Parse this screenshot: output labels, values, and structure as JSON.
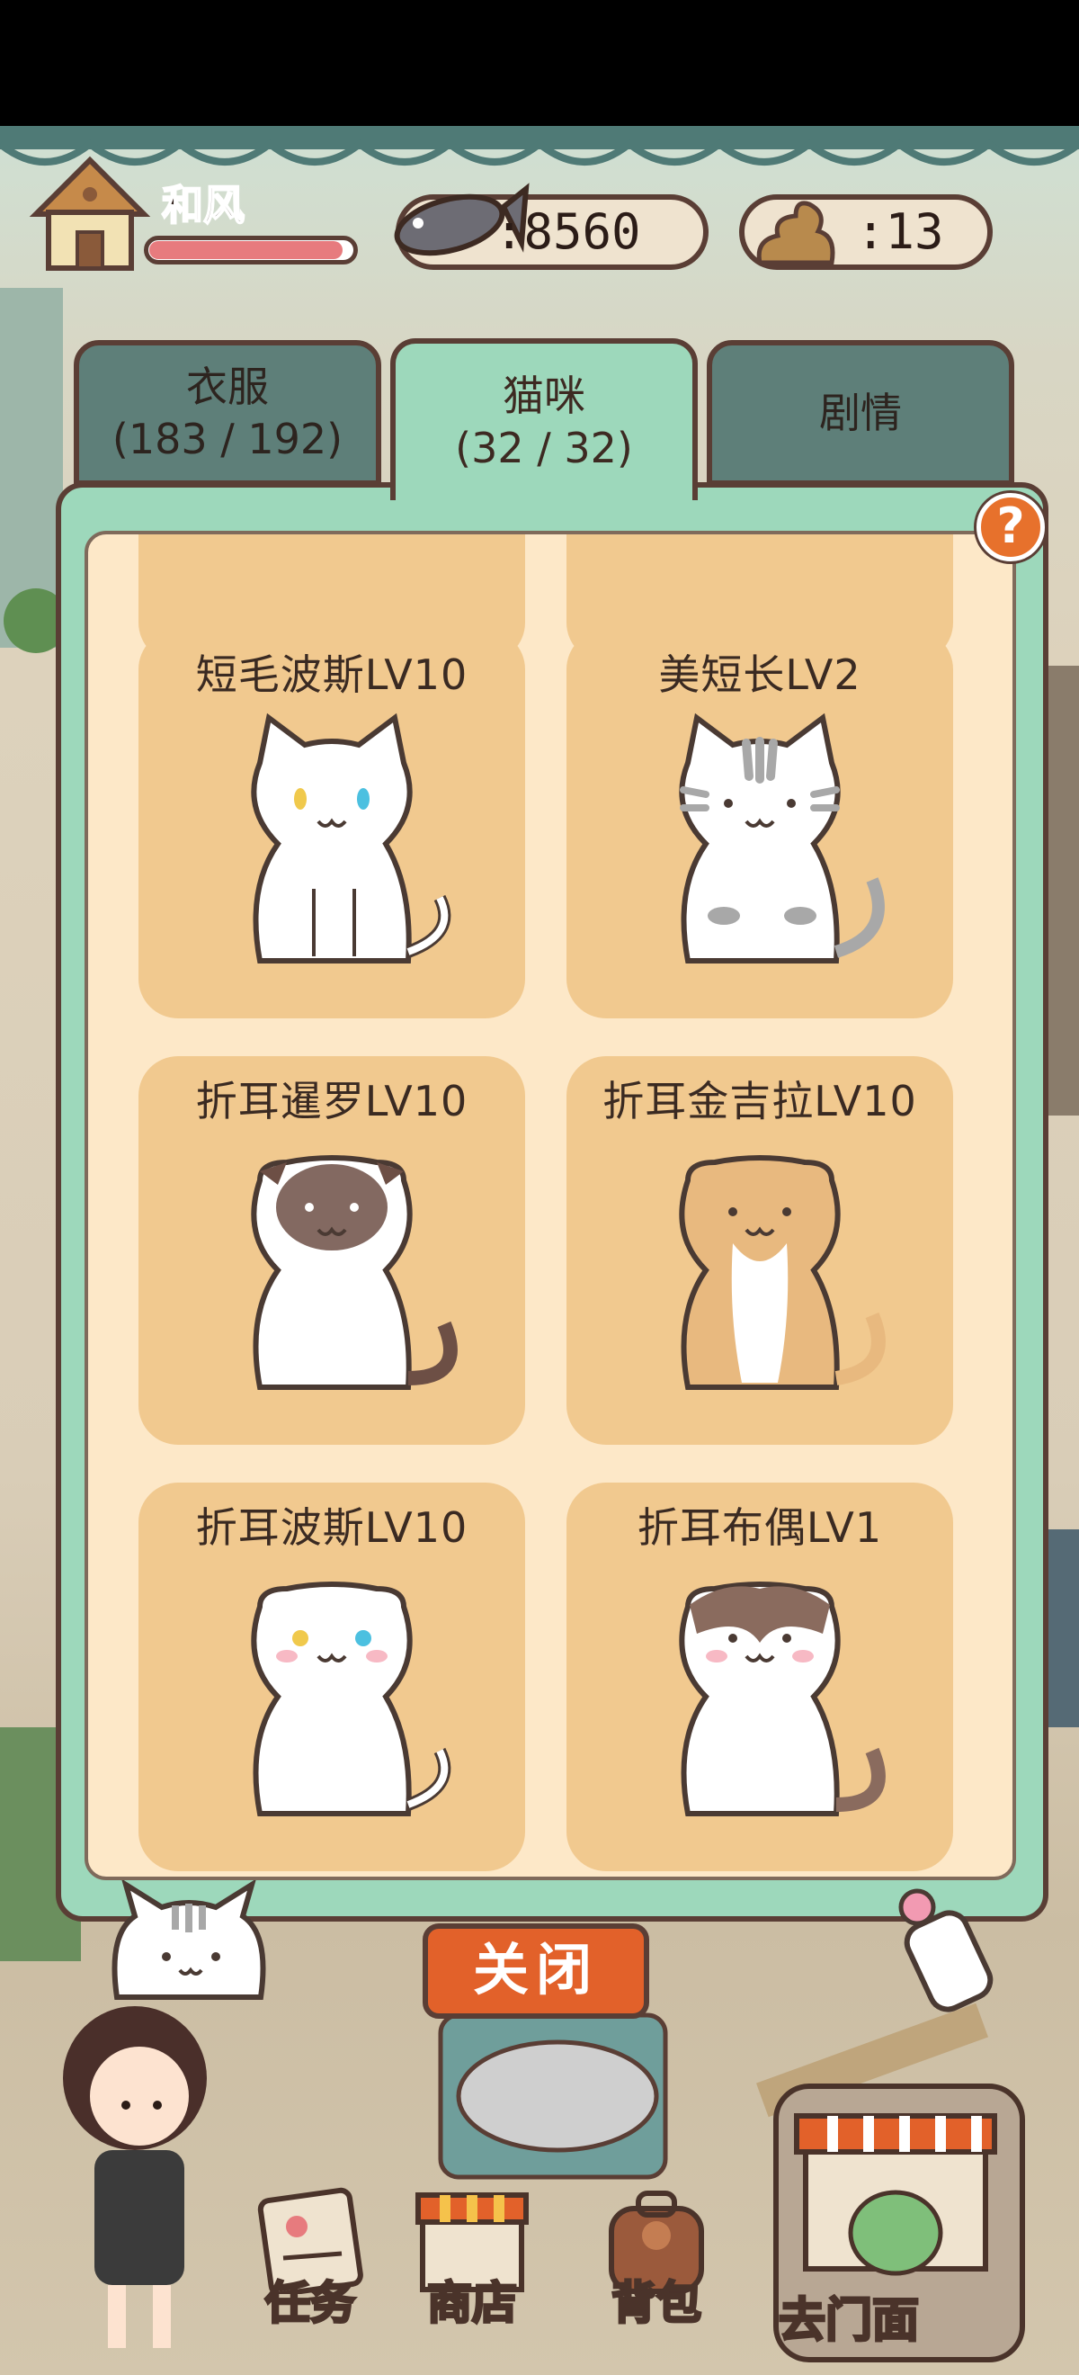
{
  "player": {
    "name": "和风",
    "xp_fraction": 0.95
  },
  "resources": {
    "fish": "8560",
    "poop": "13"
  },
  "tabs": [
    {
      "title": "衣服",
      "count": "(183 / 192)"
    },
    {
      "title": "猫咪",
      "count": "(32 / 32)"
    },
    {
      "title": "剧情"
    }
  ],
  "cats": [
    {
      "label": "短毛波斯LV10",
      "kind": "white-odd-eyes"
    },
    {
      "label": "美短长LV2",
      "kind": "silver-tabby"
    },
    {
      "label": "折耳暹罗LV10",
      "kind": "siamese-fold"
    },
    {
      "label": "折耳金吉拉LV10",
      "kind": "golden-fold"
    },
    {
      "label": "折耳波斯LV10",
      "kind": "white-fold-odd-eyes"
    },
    {
      "label": "折耳布偶LV1",
      "kind": "ragdoll-fold"
    }
  ],
  "help_label": "?",
  "close_label": "关闭",
  "nav": [
    "任务",
    "商店",
    "背包",
    "去门面"
  ],
  "colors": {
    "tab_active": "#9dd8bb",
    "card": "#f1c98f",
    "panel_bg": "#fde8c8",
    "close": "#e2612a"
  }
}
